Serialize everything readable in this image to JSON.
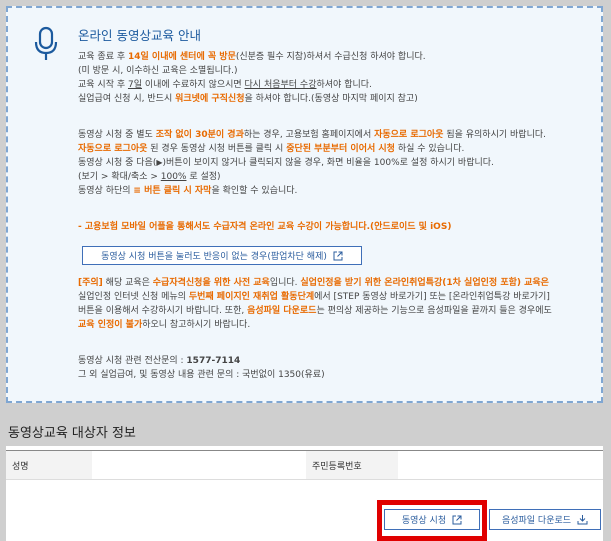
{
  "notice": {
    "title": "온라인 동영상교육 안내",
    "p1": [
      {
        "a": "교육 종료 후 ",
        "b": "14일 이내에 센터에 꼭 방문",
        "c": "(신분증 필수 지참)하셔서 수급신청 하셔야 합니다."
      },
      {
        "a": "(미 방문 시, 이수하신 교육은 소멸됩니다.)"
      },
      {
        "a": "교육 시작 후 ",
        "u": "7일",
        "c": " 이내에 수료하지 않으시면 ",
        "u2": "다시 처음부터 수강",
        "d": "하셔야 합니다."
      },
      {
        "a": "실업급여 신청 시, 반드시 ",
        "b": "워크넷에 구직신청",
        "c": "을 하셔야 합니다.(동영상 마지막 페이지 참고)"
      }
    ],
    "p2": {
      "l1a": "동영상 시청 중 별도 ",
      "l1b": "조작 없이 30분이 경과",
      "l1c": "하는 경우, 고용보험 홈페이지에서 ",
      "l1d": "자동으로 로그아웃",
      "l1e": " 됨을 유의하시기 바랍니다.",
      "l2a": "자동으로 로그아웃",
      "l2b": " 된 경우 동영상 시청 버튼를 클릭 시 ",
      "l2c": "중단된 부분부터 이어서 시청",
      "l2d": " 하실 수 있습니다.",
      "l3a": "동영상 시청 중 다음(",
      "l3tri": "▶",
      "l3b": ")버튼이 보이지 않거나 클릭되지 않을 경우, 화면 비율을 100%로 설정 하시기 바랍니다.",
      "l4a": "(보기 > 확대/축소 > ",
      "l4u": "100%",
      "l4b": " 로 설정)",
      "l5a": "동영상 하단의 ",
      "l5b": "≡ 버튼 클릭 시 자막",
      "l5c": "을 확인할 수 있습니다."
    },
    "mobile_note": "- 고용보험 모바일 어플을 통해서도 수급자격 온라인 교육 수강이 가능합니다.(안드로이드 및 iOS)",
    "popup_button_label": "동영상 시청 버튼을 눌러도 반응이 없는 경우(팝업차단 해제)",
    "p3": {
      "l1a": "[주의]",
      "l1b": " 해당 교육은 ",
      "l1c": "수급자격신청을 위한 사전 교육",
      "l1d": "입니다. ",
      "l1e": "실업인정을 받기 위한 온라인취업특강(1차 실업인정 포함) 교육은",
      "l2a": "실업인정 인터넷 신청 메뉴의 ",
      "l2b": "두번째 페이지인 재취업 활동단계",
      "l2c": "에서 [STEP 동영상 바로가기] 또는 [온라인취업특강 바로가기]",
      "l3a": "버튼을 이용해서 수강하시기 바랍니다. 또한, ",
      "l3b": "음성파일 다운로드",
      "l3c": "는 편의상 제공하는 기능으로 음성파일을 끝까지 들은 경우에도",
      "l4a": "교육 인정이 불가",
      "l4b": "하오니 참고하시기 바랍니다."
    },
    "contact1_label": "동영상 시청 관련 전산문의 : ",
    "contact1_value": "1577-7114",
    "contact2": "그 외 실업급여, 및 동영상 내용 관련 문의 : 국번없이 1350(유료)"
  },
  "section_title": "동영상교육 대상자 정보",
  "table": {
    "col1_header": "성명",
    "col1_value": "",
    "col2_header": "주민등록번호",
    "col2_value": ""
  },
  "buttons": {
    "watch": "동영상 시청",
    "download": "음성파일 다운로드"
  },
  "colors": {
    "accent": "#2b5d9e",
    "orange": "#e86a00",
    "highlight": "#e00000"
  },
  "icons": [
    "microphone-icon",
    "external-link-icon",
    "download-icon"
  ]
}
